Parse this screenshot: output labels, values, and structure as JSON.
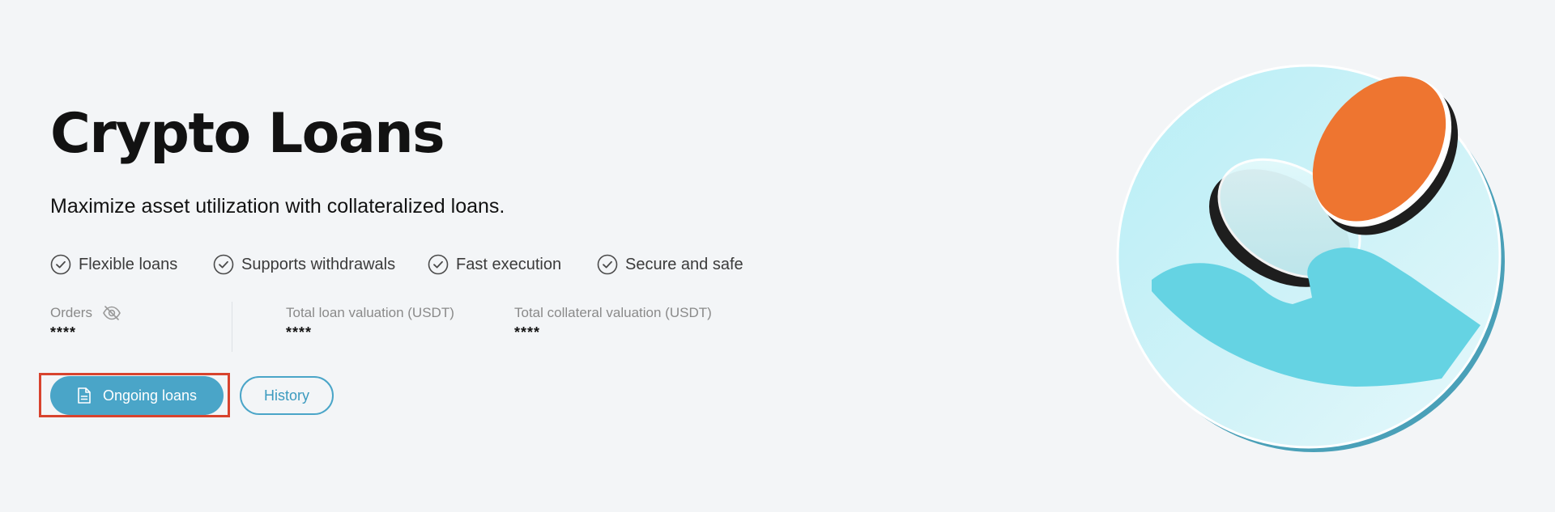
{
  "hero": {
    "title": "Crypto Loans",
    "subtitle": "Maximize asset utilization with collateralized loans."
  },
  "features": [
    {
      "label": "Flexible loans",
      "icon": "check-circle-icon"
    },
    {
      "label": "Supports withdrawals",
      "icon": "check-circle-icon"
    },
    {
      "label": "Fast execution",
      "icon": "check-circle-icon"
    },
    {
      "label": "Secure and safe",
      "icon": "check-circle-icon"
    }
  ],
  "stats": {
    "orders": {
      "label": "Orders",
      "value": "****",
      "icon": "eye-slash-icon"
    },
    "total_loan": {
      "label": "Total loan valuation (USDT)",
      "value": "****"
    },
    "total_collateral": {
      "label": "Total collateral valuation (USDT)",
      "value": "****"
    }
  },
  "buttons": {
    "ongoing": {
      "label": "Ongoing loans",
      "icon": "document-icon"
    },
    "history": {
      "label": "History"
    }
  },
  "colors": {
    "accent": "#4aa5c8",
    "background": "#f3f5f7",
    "highlight": "#d8432e",
    "coin_orange": "#ee7530",
    "hand_blue": "#65d3e3"
  }
}
